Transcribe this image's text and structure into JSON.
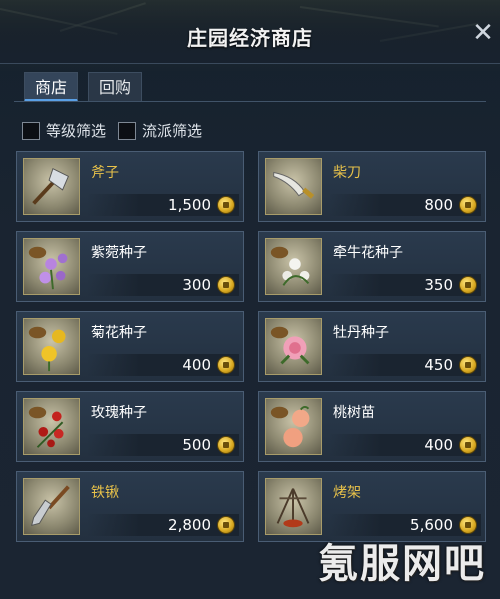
{
  "window": {
    "title": "庄园经济商店",
    "close_symbol": "✕"
  },
  "tabs": [
    {
      "label": "商店",
      "active": true
    },
    {
      "label": "回购",
      "active": false
    }
  ],
  "filters": [
    {
      "label": "等级筛选",
      "checked": false
    },
    {
      "label": "流派筛选",
      "checked": false
    }
  ],
  "items": [
    {
      "name": "斧子",
      "price": "1,500",
      "icon": "axe-icon",
      "gold": true
    },
    {
      "name": "柴刀",
      "price": "800",
      "icon": "machete-icon",
      "gold": true
    },
    {
      "name": "紫菀种子",
      "price": "300",
      "icon": "aster-seed-icon",
      "gold": false
    },
    {
      "name": "牵牛花种子",
      "price": "350",
      "icon": "morning-glory-seed-icon",
      "gold": false
    },
    {
      "name": "菊花种子",
      "price": "400",
      "icon": "chrysanthemum-seed-icon",
      "gold": false
    },
    {
      "name": "牡丹种子",
      "price": "450",
      "icon": "peony-seed-icon",
      "gold": false
    },
    {
      "name": "玫瑰种子",
      "price": "500",
      "icon": "rose-seed-icon",
      "gold": false
    },
    {
      "name": "桃树苗",
      "price": "400",
      "icon": "peach-sapling-icon",
      "gold": false
    },
    {
      "name": "铁锹",
      "price": "2,800",
      "icon": "shovel-icon",
      "gold": true
    },
    {
      "name": "烤架",
      "price": "5,600",
      "icon": "grill-icon",
      "gold": true
    }
  ],
  "currency_icon": "coin-icon",
  "watermark": "氪服网吧",
  "colors": {
    "gold_name": "#e8c24a",
    "tab_accent": "#5aa0e6",
    "panel": "#23303f"
  }
}
